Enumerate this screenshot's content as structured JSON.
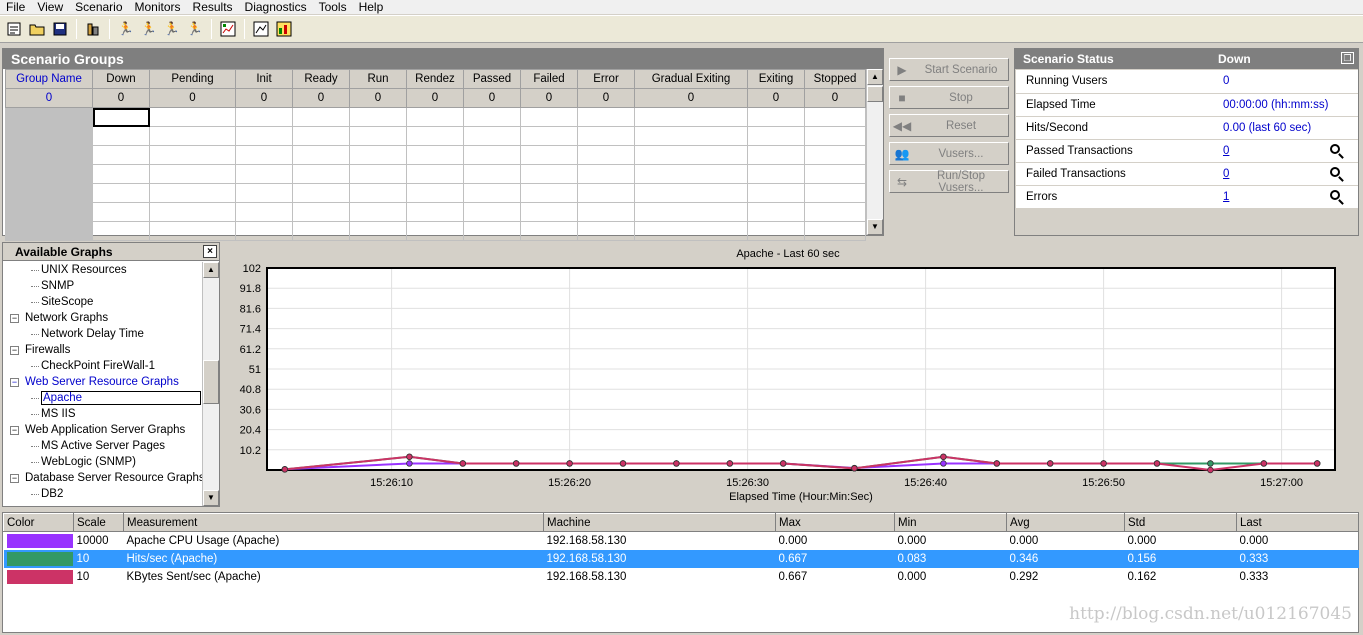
{
  "menu": [
    "File",
    "View",
    "Scenario",
    "Monitors",
    "Results",
    "Diagnostics",
    "Tools",
    "Help"
  ],
  "toolbar": {
    "icons": [
      "new-scenario-icon",
      "open-icon",
      "save-icon",
      "group-icon",
      "run-icon",
      "stop-icon",
      "gradual-stop-icon",
      "vuser-icon",
      "results-icon",
      "analyze-icon"
    ]
  },
  "scenario_groups": {
    "title": "Scenario Groups",
    "columns": [
      "Group Name",
      "Down",
      "Pending",
      "Init",
      "Ready",
      "Run",
      "Rendez",
      "Passed",
      "Failed",
      "Error",
      "Gradual Exiting",
      "Exiting",
      "Stopped"
    ],
    "totals": [
      "0",
      "0",
      "0",
      "0",
      "0",
      "0",
      "0",
      "0",
      "0",
      "0",
      "0",
      "0",
      "0"
    ]
  },
  "actions": {
    "start": "Start Scenario",
    "stop": "Stop",
    "reset": "Reset",
    "vusers": "Vusers...",
    "run_stop": "Run/Stop Vusers..."
  },
  "scenario_status": {
    "title": "Scenario Status",
    "state": "Down",
    "rows": [
      {
        "label": "Running Vusers",
        "value": "0"
      },
      {
        "label": "Elapsed Time",
        "value": "00:00:00 (hh:mm:ss)"
      },
      {
        "label": "Hits/Second",
        "value": "0.00 (last 60 sec)"
      },
      {
        "label": "Passed Transactions",
        "value": "0"
      },
      {
        "label": "Failed Transactions",
        "value": "0"
      },
      {
        "label": "Errors",
        "value": "1"
      }
    ]
  },
  "available_graphs": {
    "title": "Available Graphs",
    "close": "×",
    "items": [
      {
        "label": "UNIX Resources",
        "level": 2
      },
      {
        "label": "SNMP",
        "level": 2
      },
      {
        "label": "SiteScope",
        "level": 2
      },
      {
        "label": "Network Graphs",
        "level": 1
      },
      {
        "label": "Network Delay Time",
        "level": 2
      },
      {
        "label": "Firewalls",
        "level": 1
      },
      {
        "label": "CheckPoint FireWall-1",
        "level": 2
      },
      {
        "label": "Web Server Resource Graphs",
        "level": 1
      },
      {
        "label": "Apache",
        "level": 2
      },
      {
        "label": "MS IIS",
        "level": 2
      },
      {
        "label": "Web Application Server Graphs",
        "level": 1
      },
      {
        "label": "MS Active Server Pages",
        "level": 2
      },
      {
        "label": "WebLogic (SNMP)",
        "level": 2
      },
      {
        "label": "Database Server Resource Graphs",
        "level": 1
      },
      {
        "label": "DB2",
        "level": 2
      }
    ]
  },
  "chart_data": {
    "type": "line",
    "title": "Apache - Last 60 sec",
    "xlabel": "Elapsed Time (Hour:Min:Sec)",
    "ylabel": "",
    "yticks": [
      "102",
      "91.8",
      "81.6",
      "71.4",
      "61.2",
      "51",
      "40.8",
      "30.6",
      "20.4",
      "10.2"
    ],
    "xticks": [
      "15:26:10",
      "15:26:20",
      "15:26:30",
      "15:26:40",
      "15:26:50",
      "15:27:00"
    ],
    "ylim": [
      0,
      102
    ],
    "grid": true,
    "series": [
      {
        "name": "Apache CPU Usage (Apache)",
        "color": "#9933ff",
        "points": [
          [
            1,
            0.4
          ],
          [
            8,
            3.3
          ],
          [
            11,
            3.3
          ],
          [
            14,
            3.3
          ],
          [
            17,
            3.3
          ],
          [
            20,
            3.3
          ],
          [
            23,
            3.3
          ],
          [
            26,
            3.3
          ],
          [
            29,
            3.3
          ],
          [
            33,
            1.0
          ],
          [
            38,
            3.3
          ],
          [
            41,
            3.3
          ],
          [
            44,
            3.3
          ],
          [
            47,
            3.3
          ],
          [
            50,
            3.3
          ],
          [
            53,
            3.3
          ],
          [
            56,
            3.3
          ],
          [
            59,
            3.3
          ]
        ]
      },
      {
        "name": "Hits/sec (Apache)",
        "color": "#339966",
        "points": [
          [
            1,
            0.3
          ],
          [
            8,
            6.67
          ],
          [
            11,
            3.3
          ],
          [
            14,
            3.3
          ],
          [
            17,
            3.3
          ],
          [
            20,
            3.3
          ],
          [
            23,
            3.3
          ],
          [
            26,
            3.3
          ],
          [
            29,
            3.3
          ],
          [
            33,
            0.83
          ],
          [
            38,
            6.67
          ],
          [
            41,
            3.3
          ],
          [
            44,
            3.3
          ],
          [
            47,
            3.3
          ],
          [
            50,
            3.3
          ],
          [
            53,
            3.3
          ],
          [
            56,
            3.3
          ],
          [
            59,
            3.3
          ]
        ]
      },
      {
        "name": "KBytes Sent/sec (Apache)",
        "color": "#cc3366",
        "points": [
          [
            1,
            0.3
          ],
          [
            8,
            6.67
          ],
          [
            11,
            3.3
          ],
          [
            14,
            3.3
          ],
          [
            17,
            3.3
          ],
          [
            20,
            3.3
          ],
          [
            23,
            3.3
          ],
          [
            26,
            3.3
          ],
          [
            29,
            3.3
          ],
          [
            33,
            0.83
          ],
          [
            38,
            6.67
          ],
          [
            41,
            3.3
          ],
          [
            44,
            3.3
          ],
          [
            47,
            3.3
          ],
          [
            50,
            3.3
          ],
          [
            53,
            0.0
          ],
          [
            56,
            3.3
          ],
          [
            59,
            3.3
          ]
        ]
      }
    ]
  },
  "measurements": {
    "columns": [
      "Color",
      "Scale",
      "Measurement",
      "Machine",
      "Max",
      "Min",
      "Avg",
      "Std",
      "Last"
    ],
    "rows": [
      {
        "color": "#9933ff",
        "scale": "10000",
        "measurement": "Apache CPU Usage (Apache)",
        "machine": "192.168.58.130",
        "max": "0.000",
        "min": "0.000",
        "avg": "0.000",
        "std": "0.000",
        "last": "0.000"
      },
      {
        "color": "#339966",
        "scale": "10",
        "measurement": "Hits/sec (Apache)",
        "machine": "192.168.58.130",
        "max": "0.667",
        "min": "0.083",
        "avg": "0.346",
        "std": "0.156",
        "last": "0.333"
      },
      {
        "color": "#cc3366",
        "scale": "10",
        "measurement": "KBytes Sent/sec (Apache)",
        "machine": "192.168.58.130",
        "max": "0.667",
        "min": "0.000",
        "avg": "0.292",
        "std": "0.162",
        "last": "0.333"
      }
    ]
  },
  "watermark": "http://blog.csdn.net/u012167045"
}
